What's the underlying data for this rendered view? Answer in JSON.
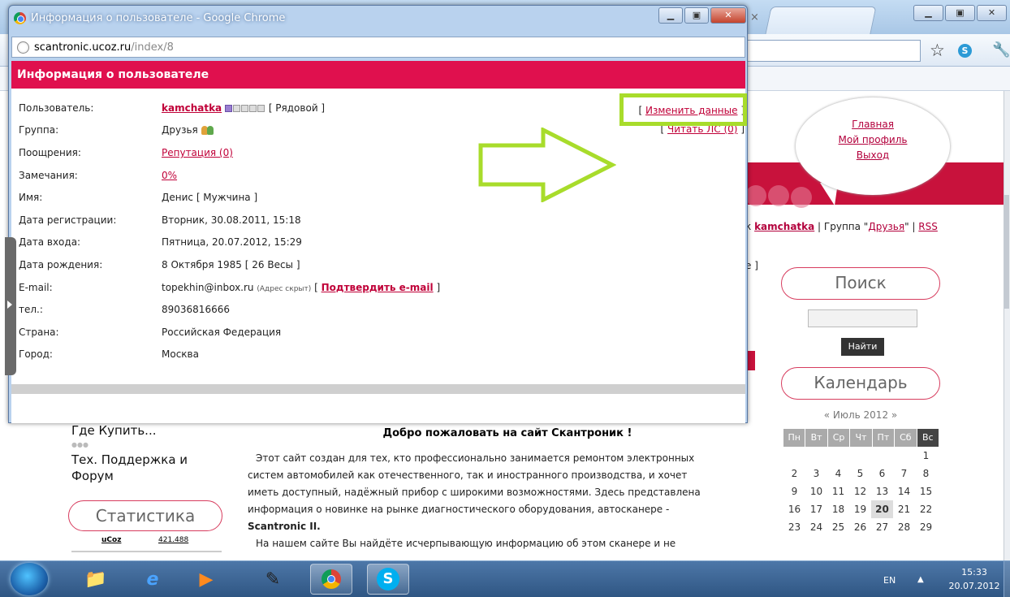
{
  "popup": {
    "window_title": "Информация о пользователе - Google Chrome",
    "url_host": "scantronic.ucoz.ru",
    "url_path": "/index/8",
    "header": "Информация о пользователе",
    "fields": [
      {
        "label": "Пользователь:",
        "value": "kamchatka",
        "extra": "[ Рядовой ]"
      },
      {
        "label": "Группа:",
        "value": "Друзья"
      },
      {
        "label": "Поощрения:",
        "value": "Репутация (0)"
      },
      {
        "label": "Замечания:",
        "value": "0%"
      },
      {
        "label": "Имя:",
        "value": "Денис [ Мужчина ]"
      },
      {
        "label": "Дата регистрации:",
        "value": "Вторник, 30.08.2011, 15:18"
      },
      {
        "label": "Дата входа:",
        "value": "Пятница, 20.07.2012, 15:29"
      },
      {
        "label": "Дата рождения:",
        "value": "8 Октября 1985 [ 26 Весы ]"
      },
      {
        "label": "E-mail:",
        "value": "topekhin@inbox.ru",
        "note": "(Адрес скрыт)",
        "link": "Подтвердить e-mail"
      },
      {
        "label": "тел.:",
        "value": "89036816666"
      },
      {
        "label": "Страна:",
        "value": "Российская Федерация"
      },
      {
        "label": "Город:",
        "value": "Москва"
      }
    ],
    "actions": {
      "edit": "Изменить данные",
      "read_pm": "Читать ЛС (0)"
    },
    "highlight_color": "#a8dc2b",
    "accent_color": "#e0104e"
  },
  "background_page": {
    "bubble_links": [
      "Главная",
      "Мой профиль",
      "Выход"
    ],
    "user_line": {
      "prefix": "к",
      "user": "kamchatka",
      "group_text": " | Группа \"",
      "group": "Друзья",
      "suffix": "\" | ",
      "rss": "RSS"
    },
    "bracket": "е ]",
    "search_title": "Поиск",
    "find_button": "Найти",
    "calendar_title": "Календарь",
    "month": "« Июль 2012 »",
    "weekdays": [
      "Пн",
      "Вт",
      "Ср",
      "Чт",
      "Пт",
      "Сб",
      "Вс"
    ],
    "calendar_rows": [
      [
        "",
        "",
        "",
        "",
        "",
        "",
        "1"
      ],
      [
        "2",
        "3",
        "4",
        "5",
        "6",
        "7",
        "8"
      ],
      [
        "9",
        "10",
        "11",
        "12",
        "13",
        "14",
        "15"
      ],
      [
        "16",
        "17",
        "18",
        "19",
        "20",
        "21",
        "22"
      ],
      [
        "23",
        "24",
        "25",
        "26",
        "27",
        "28",
        "29"
      ]
    ],
    "today": "20",
    "left_menu": [
      "Где Купить...",
      "Тех. Поддержка и",
      "Форум"
    ],
    "stat_title": "Статистика",
    "ucoz_label": "uCoz",
    "ucoz_count": "421.488",
    "main_title": "Добро пожаловать на сайт Скантроник !",
    "main_text": [
      "Этот сайт создан для тех, кто профессионально занимается ремонтом электронных",
      "систем автомобилей как отечественного, так и иностранного производства, и хочет",
      "иметь доступный, надёжный прибор с широкими возможностями. Здесь представлена",
      "информация о новинке на рынке диагностического оборудования, автосканере -",
      "Scantronic II.",
      "На нашем сайте Вы найдёте исчерпывающую информацию об этом сканере и не"
    ]
  },
  "taskbar": {
    "language": "EN",
    "time": "15:33",
    "date": "20.07.2012"
  }
}
